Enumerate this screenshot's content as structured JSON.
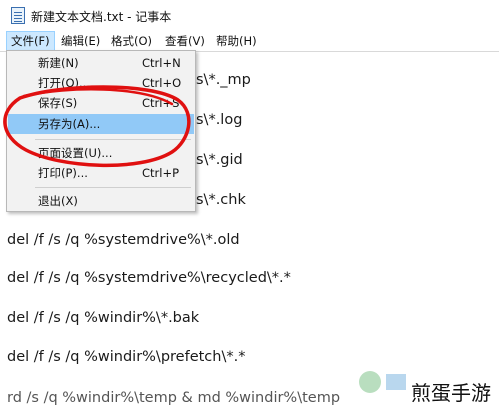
{
  "window": {
    "title": "新建文本文档.txt - 记事本"
  },
  "menubar": {
    "items": [
      {
        "label": "文件(F)"
      },
      {
        "label": "编辑(E)"
      },
      {
        "label": "格式(O)"
      },
      {
        "label": "查看(V)"
      },
      {
        "label": "帮助(H)"
      }
    ]
  },
  "file_menu": {
    "items": [
      {
        "label": "新建(N)",
        "shortcut": "Ctrl+N"
      },
      {
        "label": "打开(O)...",
        "shortcut": "Ctrl+O"
      },
      {
        "label": "保存(S)",
        "shortcut": "Ctrl+S"
      },
      {
        "label": "另存为(A)...",
        "shortcut": ""
      },
      {
        "label": "页面设置(U)...",
        "shortcut": ""
      },
      {
        "label": "打印(P)...",
        "shortcut": "Ctrl+P"
      },
      {
        "label": "退出(X)",
        "shortcut": ""
      }
    ]
  },
  "editor": {
    "partial_lines": [
      "s\\*._mp",
      "s\\*.log",
      "s\\*.gid",
      "s\\*.chk"
    ],
    "lines": [
      "del /f /s /q %systemdrive%\\*.old",
      "del /f /s /q %systemdrive%\\recycled\\*.*",
      "del /f /s /q %windir%\\*.bak",
      "del /f /s /q %windir%\\prefetch\\*.*",
      "rd /s /q %windir%\\temp & md %windir%\\temp"
    ]
  },
  "watermark": {
    "text": "煎蛋手游"
  },
  "colors": {
    "highlight": "#91c9f7",
    "menu_active": "#cce8ff",
    "annotation": "#e01010"
  }
}
